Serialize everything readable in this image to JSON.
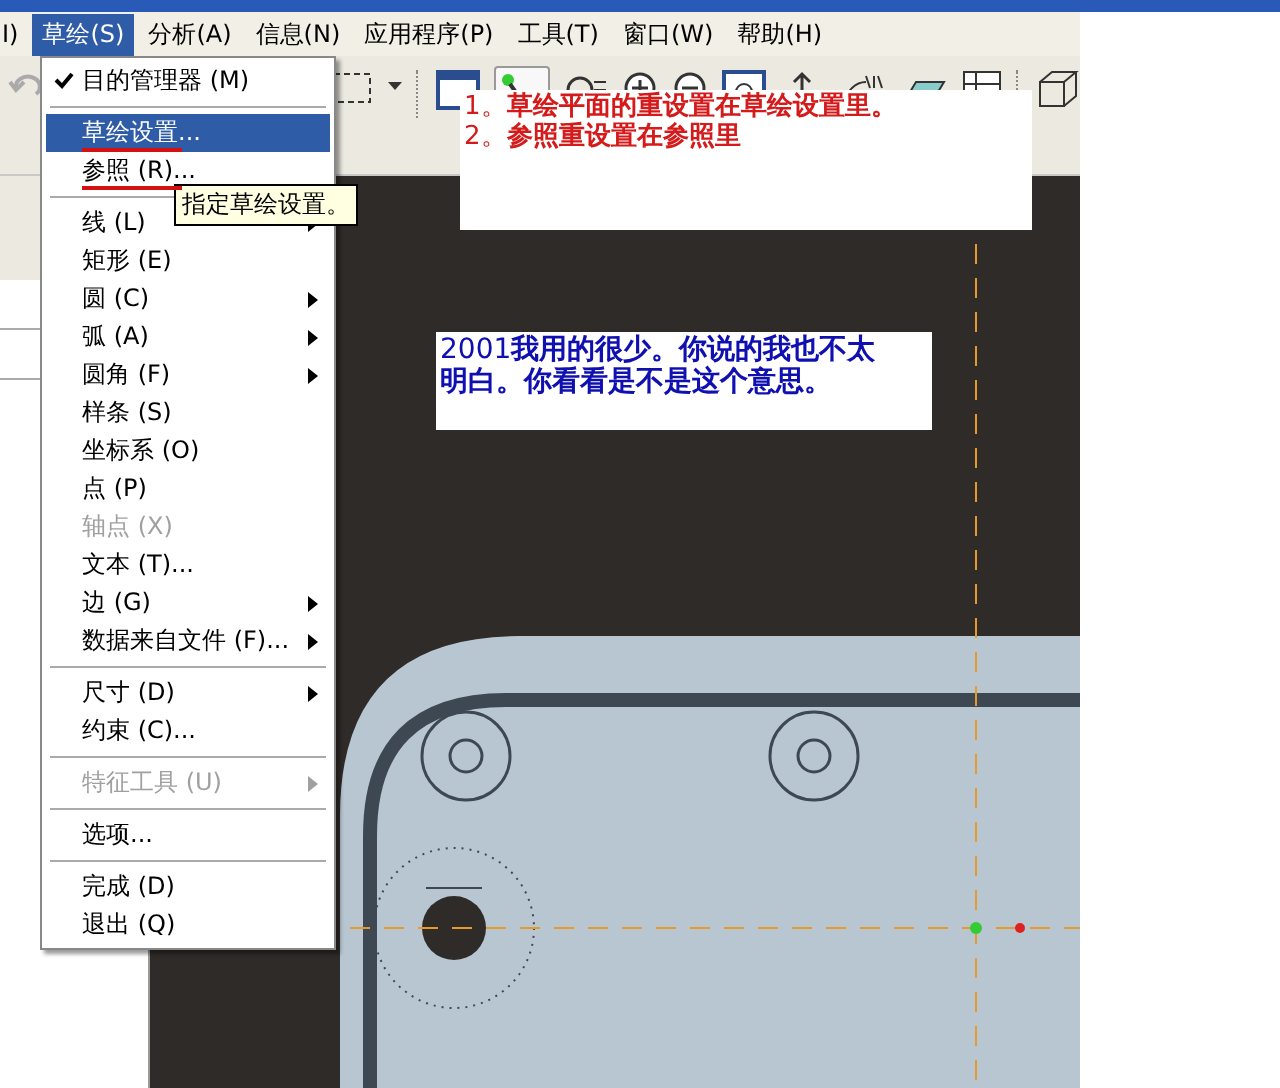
{
  "menubar": [
    {
      "label": "I)",
      "selected": false
    },
    {
      "label": "草绘(S)",
      "selected": true
    },
    {
      "label": "分析(A)",
      "selected": false
    },
    {
      "label": "信息(N)",
      "selected": false
    },
    {
      "label": "应用程序(P)",
      "selected": false
    },
    {
      "label": "工具(T)",
      "selected": false
    },
    {
      "label": "窗口(W)",
      "selected": false
    },
    {
      "label": "帮助(H)",
      "selected": false
    }
  ],
  "dropdown": {
    "items": [
      {
        "kind": "item",
        "label": "目的管理器 (M)",
        "checked": true,
        "selected": false,
        "disabled": false,
        "submenu": false,
        "marked": false
      },
      {
        "kind": "separator"
      },
      {
        "kind": "item",
        "label": "草绘设置...",
        "checked": false,
        "selected": true,
        "disabled": false,
        "submenu": false,
        "marked": true
      },
      {
        "kind": "item",
        "label": "参照 (R)...",
        "checked": false,
        "selected": false,
        "disabled": false,
        "submenu": false,
        "marked": true
      },
      {
        "kind": "separator"
      },
      {
        "kind": "item",
        "label": "线 (L)",
        "checked": false,
        "selected": false,
        "disabled": false,
        "submenu": true,
        "marked": false
      },
      {
        "kind": "item",
        "label": "矩形 (E)",
        "checked": false,
        "selected": false,
        "disabled": false,
        "submenu": false,
        "marked": false
      },
      {
        "kind": "item",
        "label": "圆 (C)",
        "checked": false,
        "selected": false,
        "disabled": false,
        "submenu": true,
        "marked": false
      },
      {
        "kind": "item",
        "label": "弧 (A)",
        "checked": false,
        "selected": false,
        "disabled": false,
        "submenu": true,
        "marked": false
      },
      {
        "kind": "item",
        "label": "圆角 (F)",
        "checked": false,
        "selected": false,
        "disabled": false,
        "submenu": true,
        "marked": false
      },
      {
        "kind": "item",
        "label": "样条 (S)",
        "checked": false,
        "selected": false,
        "disabled": false,
        "submenu": false,
        "marked": false
      },
      {
        "kind": "item",
        "label": "坐标系 (O)",
        "checked": false,
        "selected": false,
        "disabled": false,
        "submenu": false,
        "marked": false
      },
      {
        "kind": "item",
        "label": "点 (P)",
        "checked": false,
        "selected": false,
        "disabled": false,
        "submenu": false,
        "marked": false
      },
      {
        "kind": "item",
        "label": "轴点 (X)",
        "checked": false,
        "selected": false,
        "disabled": true,
        "submenu": false,
        "marked": false
      },
      {
        "kind": "item",
        "label": "文本 (T)...",
        "checked": false,
        "selected": false,
        "disabled": false,
        "submenu": false,
        "marked": false
      },
      {
        "kind": "item",
        "label": "边 (G)",
        "checked": false,
        "selected": false,
        "disabled": false,
        "submenu": true,
        "marked": false
      },
      {
        "kind": "item",
        "label": "数据来自文件 (F)...",
        "checked": false,
        "selected": false,
        "disabled": false,
        "submenu": true,
        "marked": false
      },
      {
        "kind": "separator"
      },
      {
        "kind": "item",
        "label": "尺寸 (D)",
        "checked": false,
        "selected": false,
        "disabled": false,
        "submenu": true,
        "marked": false
      },
      {
        "kind": "item",
        "label": "约束 (C)...",
        "checked": false,
        "selected": false,
        "disabled": false,
        "submenu": false,
        "marked": false
      },
      {
        "kind": "separator"
      },
      {
        "kind": "item",
        "label": "特征工具 (U)",
        "checked": false,
        "selected": false,
        "disabled": true,
        "submenu": true,
        "marked": false
      },
      {
        "kind": "separator"
      },
      {
        "kind": "item",
        "label": "选项...",
        "checked": false,
        "selected": false,
        "disabled": false,
        "submenu": false,
        "marked": false
      },
      {
        "kind": "separator"
      },
      {
        "kind": "item",
        "label": "完成 (D)",
        "checked": false,
        "selected": false,
        "disabled": false,
        "submenu": false,
        "marked": false
      },
      {
        "kind": "item",
        "label": "退出 (Q)",
        "checked": false,
        "selected": false,
        "disabled": false,
        "submenu": false,
        "marked": false
      }
    ]
  },
  "tooltip": "指定草绘设置。",
  "annotations": [
    {
      "kind": "red",
      "lines": [
        "1。**草绘平面的重设置在草绘设置里。**",
        "2。**参照重设置在参照里**"
      ]
    },
    {
      "kind": "blue",
      "lines": [
        "2001**我用的很少。你说的我也不太明白。你看看是不是这个意思。**"
      ]
    }
  ]
}
